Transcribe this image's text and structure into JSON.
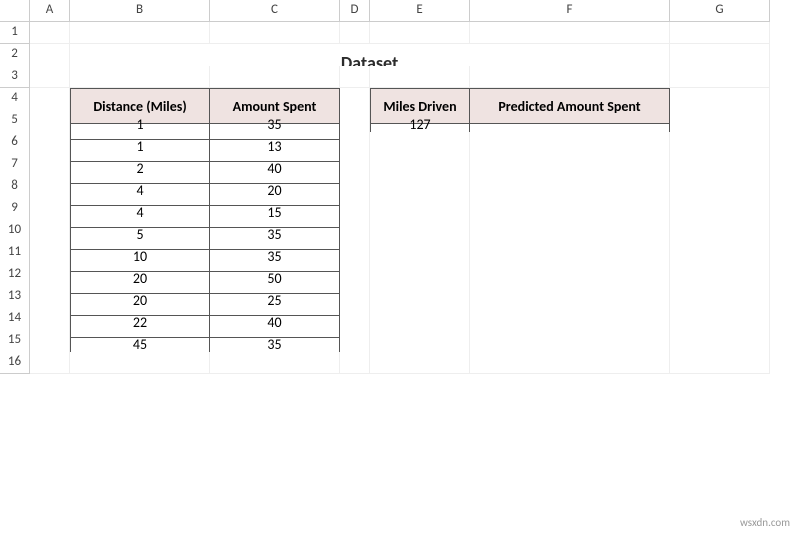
{
  "columns": [
    "A",
    "B",
    "C",
    "D",
    "E",
    "F",
    "G"
  ],
  "rows": [
    "1",
    "2",
    "3",
    "4",
    "5",
    "6",
    "7",
    "8",
    "9",
    "10",
    "11",
    "12",
    "13",
    "14",
    "15",
    "16"
  ],
  "title": "Dataset",
  "table1": {
    "header_b": "Distance (Miles)",
    "header_c": "Amount Spent",
    "data": [
      {
        "b": "1",
        "c": "35"
      },
      {
        "b": "1",
        "c": "13"
      },
      {
        "b": "2",
        "c": "40"
      },
      {
        "b": "4",
        "c": "20"
      },
      {
        "b": "4",
        "c": "15"
      },
      {
        "b": "5",
        "c": "35"
      },
      {
        "b": "10",
        "c": "35"
      },
      {
        "b": "20",
        "c": "50"
      },
      {
        "b": "20",
        "c": "25"
      },
      {
        "b": "22",
        "c": "40"
      },
      {
        "b": "45",
        "c": "35"
      }
    ]
  },
  "table2": {
    "header_e": "Miles Driven",
    "header_f": "Predicted Amount Spent",
    "data": [
      {
        "e": "127",
        "f": ""
      }
    ]
  },
  "watermark": "wsxdn.com"
}
